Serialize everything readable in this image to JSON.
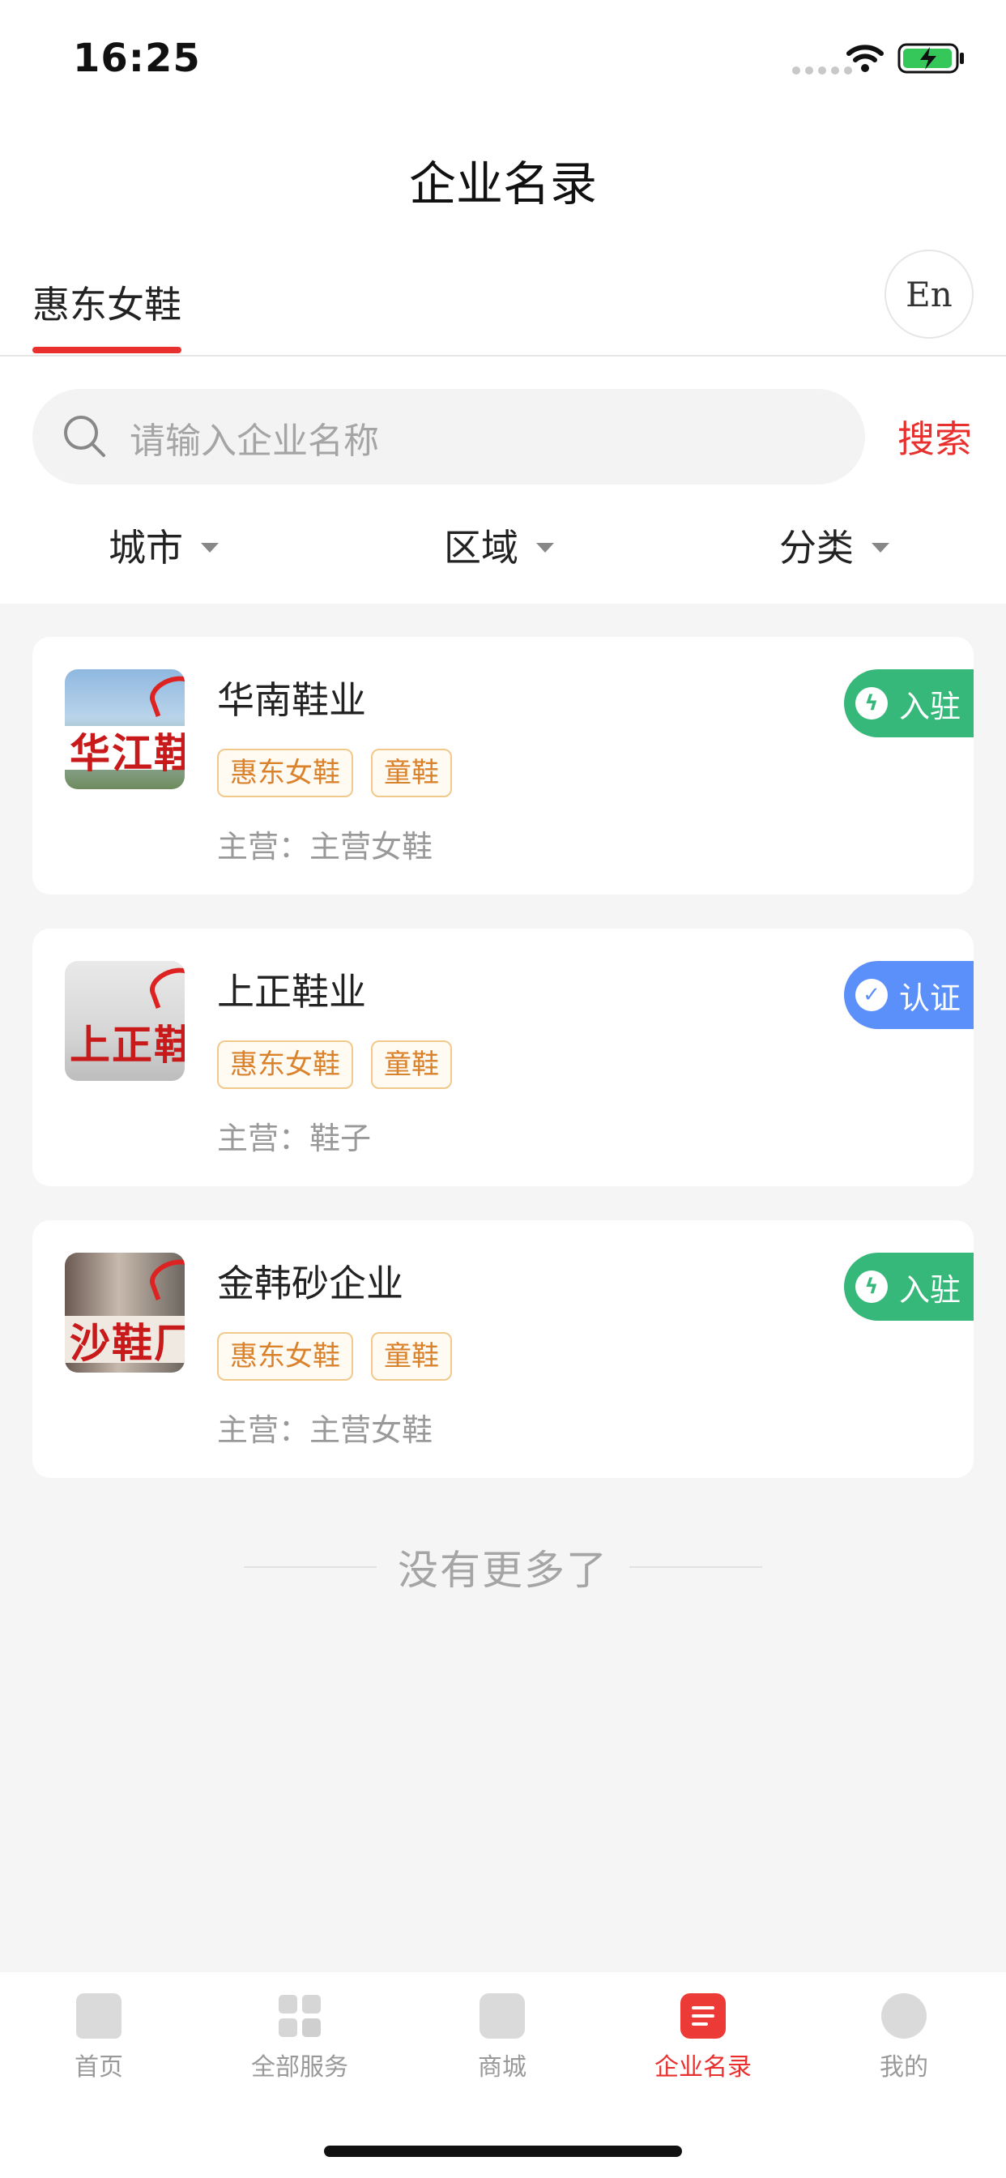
{
  "status_bar": {
    "time": "16:25"
  },
  "header": {
    "title": "企业名录"
  },
  "tabs": {
    "active_label": "惠东女鞋",
    "lang_button": "En"
  },
  "search": {
    "placeholder": "请输入企业名称",
    "button_label": "搜索"
  },
  "filters": [
    {
      "label": "城市"
    },
    {
      "label": "区域"
    },
    {
      "label": "分类"
    }
  ],
  "companies": [
    {
      "name": "华南鞋业",
      "thumb_text": "华江鞋",
      "tags": [
        "惠东女鞋",
        "童鞋"
      ],
      "main_business": "主营：主营女鞋",
      "badge": "入驻",
      "badge_color": "#35b879"
    },
    {
      "name": "上正鞋业",
      "thumb_text": "上正鞋",
      "tags": [
        "惠东女鞋",
        "童鞋"
      ],
      "main_business": "主营：鞋子",
      "badge": "认证",
      "badge_color": "#5b8ff9"
    },
    {
      "name": "金韩砂企业",
      "thumb_text": "沙鞋厂",
      "tags": [
        "惠东女鞋",
        "童鞋"
      ],
      "main_business": "主营：主营女鞋",
      "badge": "入驻",
      "badge_color": "#35b879"
    }
  ],
  "list_footer": "没有更多了",
  "bottom_nav": [
    {
      "label": "首页",
      "icon": "home-icon"
    },
    {
      "label": "全部服务",
      "icon": "grid-icon"
    },
    {
      "label": "商城",
      "icon": "shop-icon"
    },
    {
      "label": "企业名录",
      "icon": "directory-icon",
      "active": true
    },
    {
      "label": "我的",
      "icon": "profile-icon"
    }
  ],
  "colors": {
    "accent": "#e8312f",
    "tag_text": "#d9822b",
    "tag_border": "#f3c98b"
  }
}
